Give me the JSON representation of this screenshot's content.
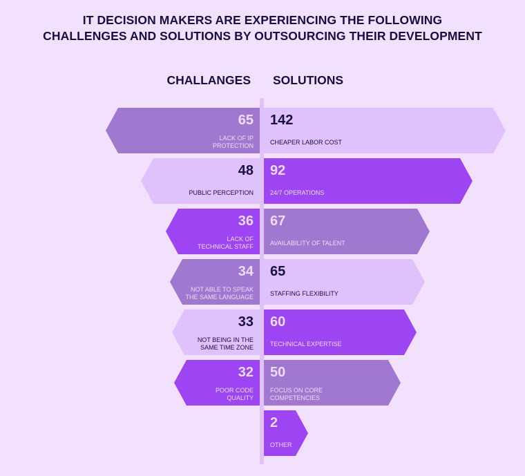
{
  "title_lines": [
    "IT DECISION MAKERS ARE EXPERIENCING THE FOLLOWING",
    "CHALLENGES AND SOLUTIONS BY OUTSOURCING THEIR DEVELOPMENT"
  ],
  "headers": {
    "left": "CHALLANGES",
    "right": "SOLUTIONS"
  },
  "colors": {
    "background": "#f1e1fd",
    "divider": "#dfc2fb",
    "medium": "#a178cf",
    "light": "#dfc2fb",
    "bright": "#9d45f3",
    "text_dark": "#170f3f",
    "text_light": "#ecdcfb"
  },
  "chart_data": {
    "type": "bar",
    "title": "IT decision makers are experiencing the following challenges and solutions by outsourcing their development",
    "orientation": "horizontal-diverging",
    "series": [
      {
        "name": "CHALLANGES",
        "side": "left",
        "items": [
          {
            "label": "LACK OF IP PROTECTION",
            "lines": [
              "LACK OF IP",
              "PROTECTION"
            ],
            "value": 65,
            "tone": "medium"
          },
          {
            "label": "PUBLIC PERCEPTION",
            "lines": [
              "PUBLIC PERCEPTION"
            ],
            "value": 48,
            "tone": "light"
          },
          {
            "label": "LACK OF TECHNICAL STAFF",
            "lines": [
              "LACK OF",
              "TECHNICAL STAFF"
            ],
            "value": 36,
            "tone": "bright"
          },
          {
            "label": "NOT ABLE TO SPEAK THE SAME LANGUAGE",
            "lines": [
              "NOT ABLE TO SPEAK",
              "THE SAME LANGUAGE"
            ],
            "value": 34,
            "tone": "medium"
          },
          {
            "label": "NOT BEING IN THE SAME TIME ZONE",
            "lines": [
              "NOT BEING IN THE",
              "SAME TIME ZONE"
            ],
            "value": 33,
            "tone": "light"
          },
          {
            "label": "POOR CODE QUALITY",
            "lines": [
              "POOR CODE",
              "QUALITY"
            ],
            "value": 32,
            "tone": "bright"
          }
        ]
      },
      {
        "name": "SOLUTIONS",
        "side": "right",
        "items": [
          {
            "label": "CHEAPER LABOR COST",
            "lines": [
              "CHEAPER LABOR COST"
            ],
            "value": 142,
            "tone": "light"
          },
          {
            "label": "24/7 OPERATIONS",
            "lines": [
              "24/7 OPERATIONS"
            ],
            "value": 92,
            "tone": "bright"
          },
          {
            "label": "AVAILABILITY OF TALENT",
            "lines": [
              "AVAILABILITY OF TALENT"
            ],
            "value": 67,
            "tone": "medium"
          },
          {
            "label": "STAFFING FLEXIBILITY",
            "lines": [
              "STAFFING FLEXIBILITY"
            ],
            "value": 65,
            "tone": "light"
          },
          {
            "label": "TECHNICAL EXPERTISE",
            "lines": [
              "TECHNICAL EXPERTISE"
            ],
            "value": 60,
            "tone": "bright"
          },
          {
            "label": "FOCUS ON CORE COMPETENCIES",
            "lines": [
              "FOCUS ON CORE",
              "COMPETENCIES"
            ],
            "value": 50,
            "tone": "medium"
          },
          {
            "label": "OTHER",
            "lines": [
              "OTHER"
            ],
            "value": 2,
            "tone": "bright"
          }
        ]
      }
    ]
  }
}
